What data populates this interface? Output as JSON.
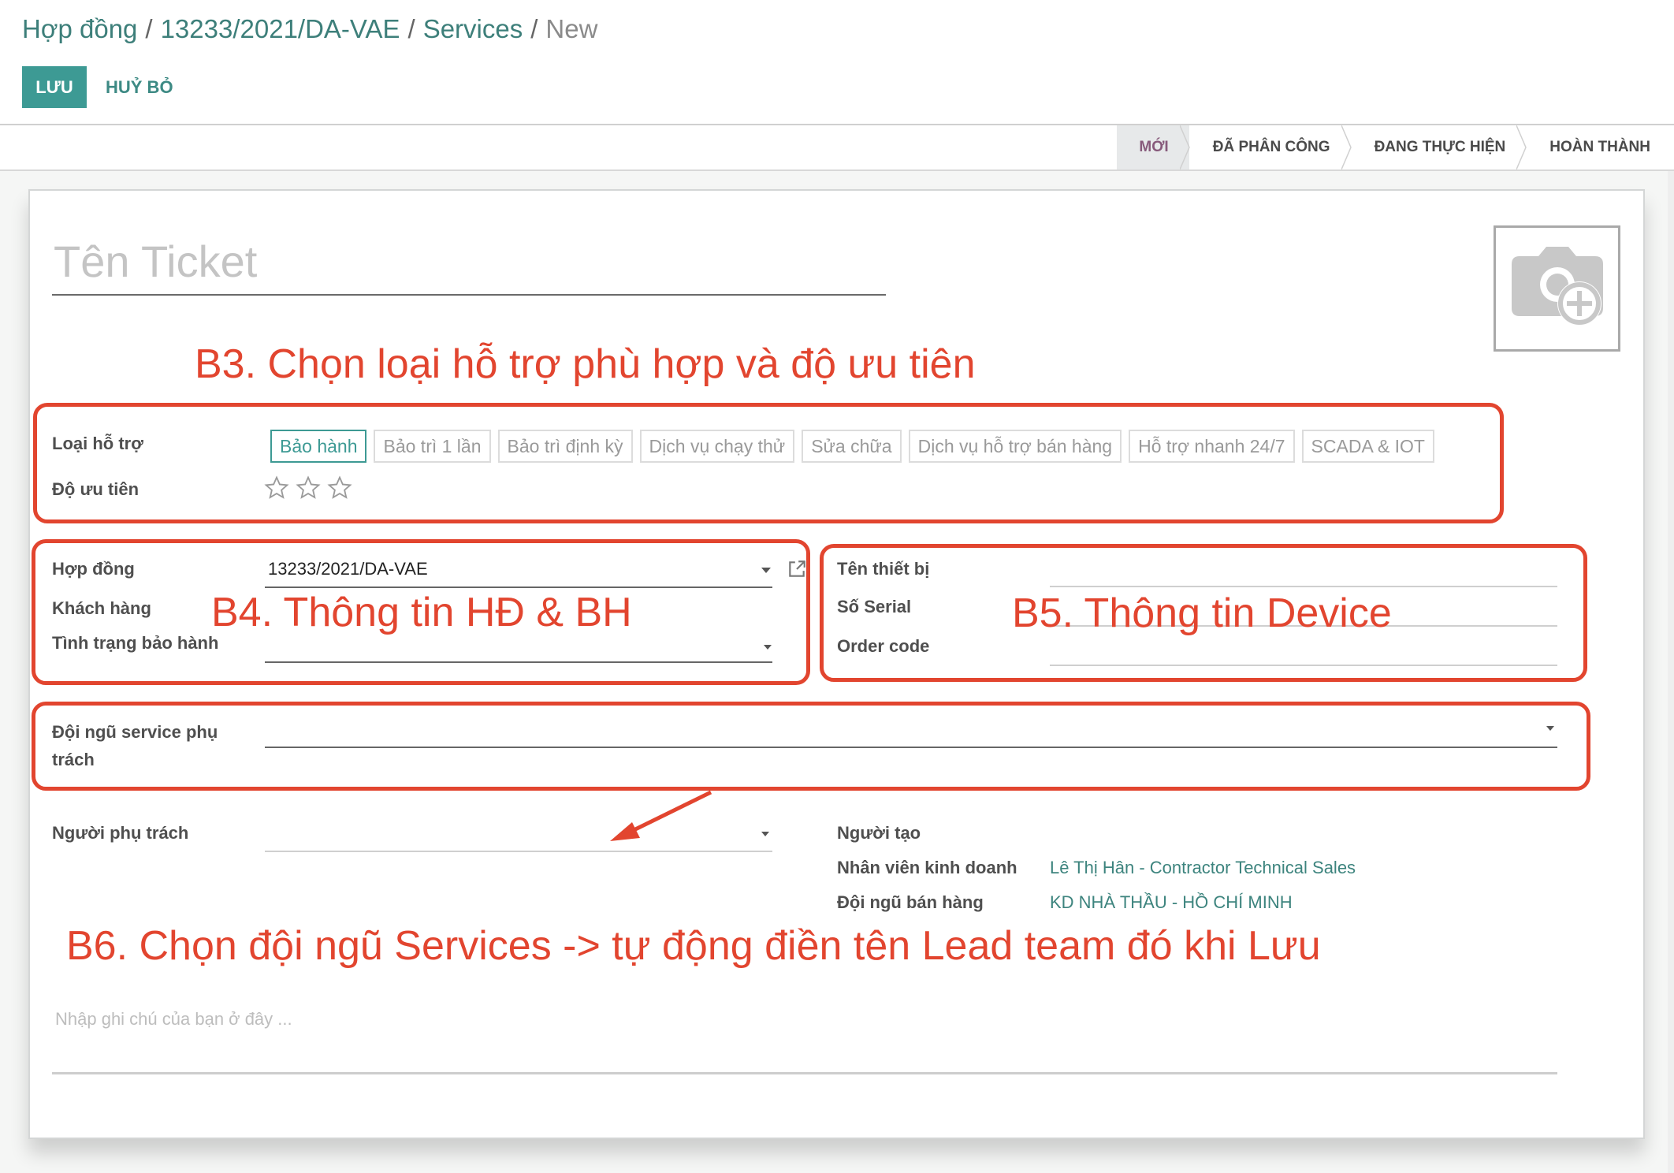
{
  "breadcrumb": {
    "items": [
      "Hợp đồng",
      "13233/2021/DA-VAE",
      "Services"
    ],
    "separator": "/",
    "current": "New"
  },
  "toolbar": {
    "save_label": "LƯU",
    "discard_label": "HUỶ BỎ"
  },
  "statusbar": {
    "stages": [
      {
        "label": "MỚI",
        "current": true
      },
      {
        "label": "ĐÃ PHÂN CÔNG",
        "current": false
      },
      {
        "label": "ĐANG THỰC HIỆN",
        "current": false
      },
      {
        "label": "HOÀN THÀNH",
        "current": false
      }
    ]
  },
  "form": {
    "title_placeholder": "Tên Ticket",
    "title_value": "",
    "support_type": {
      "label": "Loại hỗ trợ",
      "options": [
        "Bảo hành",
        "Bảo trì 1 lần",
        "Bảo trì định kỳ",
        "Dịch vụ chạy thử",
        "Sửa chữa",
        "Dịch vụ hỗ trợ bán hàng",
        "Hỗ trợ nhanh 24/7",
        "SCADA & IOT"
      ],
      "selected": "Bảo hành"
    },
    "priority": {
      "label": "Độ ưu tiên",
      "max_stars": 3,
      "value": 0
    },
    "contract": {
      "label": "Hợp đồng",
      "value": "13233/2021/DA-VAE"
    },
    "customer": {
      "label": "Khách hàng",
      "value": ""
    },
    "warranty_status": {
      "label": "Tình trạng bảo hành",
      "value": ""
    },
    "device_name": {
      "label": "Tên thiết bị",
      "value": ""
    },
    "serial": {
      "label": "Số Serial",
      "value": ""
    },
    "order_code": {
      "label": "Order code",
      "value": ""
    },
    "service_team": {
      "label": "Đội ngũ service phụ trách",
      "value": ""
    },
    "assignee": {
      "label": "Người phụ trách",
      "value": ""
    },
    "creator": {
      "label": "Người tạo",
      "value": ""
    },
    "salesperson": {
      "label": "Nhân viên kinh doanh",
      "value": "Lê Thị Hân - Contractor Technical Sales"
    },
    "sales_team": {
      "label": "Đội ngũ bán hàng",
      "value": "KD NHÀ THẦU - HỒ CHÍ MINH"
    },
    "note_placeholder": "Nhập ghi chú của bạn ở đây ..."
  },
  "annotations": {
    "b3": "B3. Chọn loại hỗ trợ phù hợp và độ ưu tiên",
    "b4": "B4. Thông tin HĐ & BH",
    "b5": "B5. Thông tin Device",
    "b6": "B6. Chọn đội ngũ Services -> tự động điền tên Lead team đó khi Lưu",
    "color": "#e2452f"
  },
  "colors": {
    "brand": "#3d9a94",
    "link": "#3d847e",
    "current_stage": "#875a7b"
  }
}
